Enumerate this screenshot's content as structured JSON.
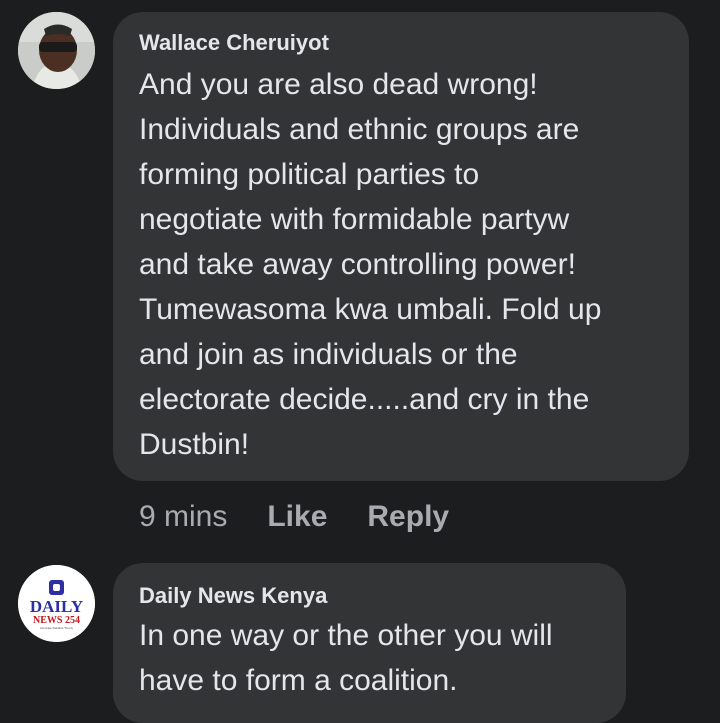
{
  "comments": [
    {
      "author": "Wallace Cheruiyot",
      "avatar_icon": "user-photo",
      "lines": [
        "And you are also dead wrong!",
        "Individuals and ethnic groups are",
        "forming political parties to",
        "negotiate with formidable partyw",
        "and take away controlling power!",
        "Tumewasoma kwa umbali. Fold up",
        "and join as individuals or the",
        "electorate decide.....and cry in the",
        "Dustbin!"
      ],
      "time": "9 mins",
      "like_label": "Like",
      "reply_label": "Reply"
    },
    {
      "author": "Daily News Kenya",
      "avatar_logo": {
        "top": "DAILY",
        "bottom": "NEWS 254",
        "tagline": "Accurate Reliable Timely"
      },
      "lines": [
        "In one way or the other you will",
        "have to form a coalition."
      ]
    }
  ],
  "colors": {
    "background": "#1c1d1f",
    "bubble": "#333436",
    "text": "#e4e6eb",
    "secondary": "#a8abaf",
    "logo_blue": "#2d2fa3",
    "logo_red": "#c4151c"
  }
}
